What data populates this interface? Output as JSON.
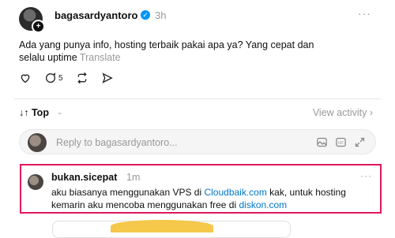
{
  "post": {
    "username": "bagasardyantoro",
    "time": "3h",
    "more": "···",
    "text": "Ada yang punya info, hosting terbaik pakai apa ya? Yang cepat dan selalu uptime",
    "translate": "Translate",
    "reply_count": "5",
    "icons": [
      "heart-icon",
      "comment-icon",
      "repost-icon",
      "share-icon"
    ]
  },
  "sort": {
    "label": "↓↑ Top",
    "chevron": "⌄",
    "view_activity": "View activity ›"
  },
  "reply": {
    "placeholder": "Reply to bagasardyantoro..."
  },
  "comment": {
    "username": "bukan.sicepat",
    "time": "1m",
    "more": "···",
    "text_1": "aku biasanya menggunakan VPS di ",
    "link_1": "Cloudbaik.com",
    "text_2": " kak, untuk hosting kemarin aku mencoba menggunakan free di ",
    "link_2": "diskon.com",
    "link_color": "#0077c8",
    "highlight_color": "#e0185a"
  }
}
